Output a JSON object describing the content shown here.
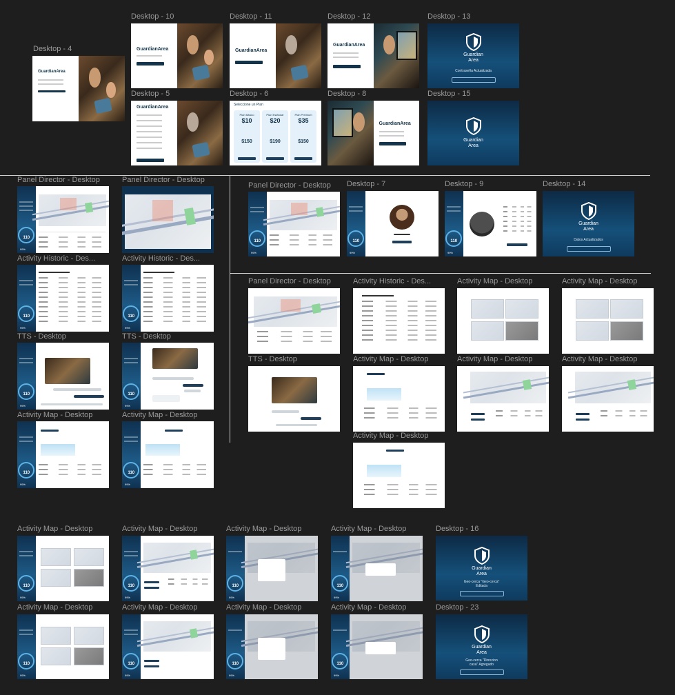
{
  "frame_labels": {
    "d4": "Desktop - 4",
    "d10": "Desktop - 10",
    "d11": "Desktop - 11",
    "d12": "Desktop - 12",
    "d13": "Desktop - 13",
    "d5": "Desktop - 5",
    "d6": "Desktop - 6",
    "d8": "Desktop - 8",
    "d15": "Desktop - 15",
    "pd1": "Panel Director - Desktop",
    "pd2": "Panel Director - Desktop",
    "pd3": "Panel Director - Desktop",
    "d7": "Desktop - 7",
    "d9": "Desktop - 9",
    "d14": "Desktop - 14",
    "ah1": "Activity Historic - Des...",
    "ah2": "Activity Historic - Des...",
    "pd4": "Panel Director - Desktop",
    "ah3": "Activity Historic - Des...",
    "am1": "Activity Map - Desktop",
    "am2": "Activity Map - Desktop",
    "tts1": "TTS - Desktop",
    "tts2": "TTS - Desktop",
    "tts3": "TTS - Desktop",
    "am3": "Activity Map - Desktop",
    "am4": "Activity Map - Desktop",
    "am5": "Activity Map - Desktop",
    "am6": "Activity Map - Desktop",
    "am7": "Activity Map - Desktop",
    "am8": "Activity Map - Desktop",
    "am9": "Activity Map - Desktop",
    "am10": "Activity Map - Desktop",
    "am11": "Activity Map - Desktop",
    "am12": "Activity Map - Desktop",
    "am13": "Activity Map - Desktop",
    "d16": "Desktop - 16",
    "am14": "Activity Map - Desktop",
    "am15": "Activity Map - Desktop",
    "am16": "Activity Map - Desktop",
    "am17": "Activity Map - Desktop",
    "d23": "Desktop - 23"
  },
  "brand": "GuardianArea",
  "brand_line1": "Guardian",
  "brand_line2": "Area",
  "splash_messages": {
    "d13": "Contraseña Actualizada",
    "d14": "Datos Actualizados",
    "d16": "Geo-cerca \"Geo-cerca\" Editada",
    "d23": "Geo-cerca \"Dirrecion casa\" Agregado"
  },
  "plans": {
    "title": "Seleccione un Plan",
    "items": [
      {
        "name": "Plan Básico",
        "price": "$10",
        "year": "$150"
      },
      {
        "name": "Plan Estándar",
        "price": "$20",
        "year": "$190"
      },
      {
        "name": "Plan Premium",
        "price": "$35",
        "year": "$150"
      }
    ]
  },
  "dashboard": {
    "heart_value": "110",
    "battery": "99%"
  },
  "colors": {
    "background": "#1e1e1e",
    "navy": "#13344a",
    "sidebar": "#1d5a86",
    "accent": "#5fb2e6"
  }
}
